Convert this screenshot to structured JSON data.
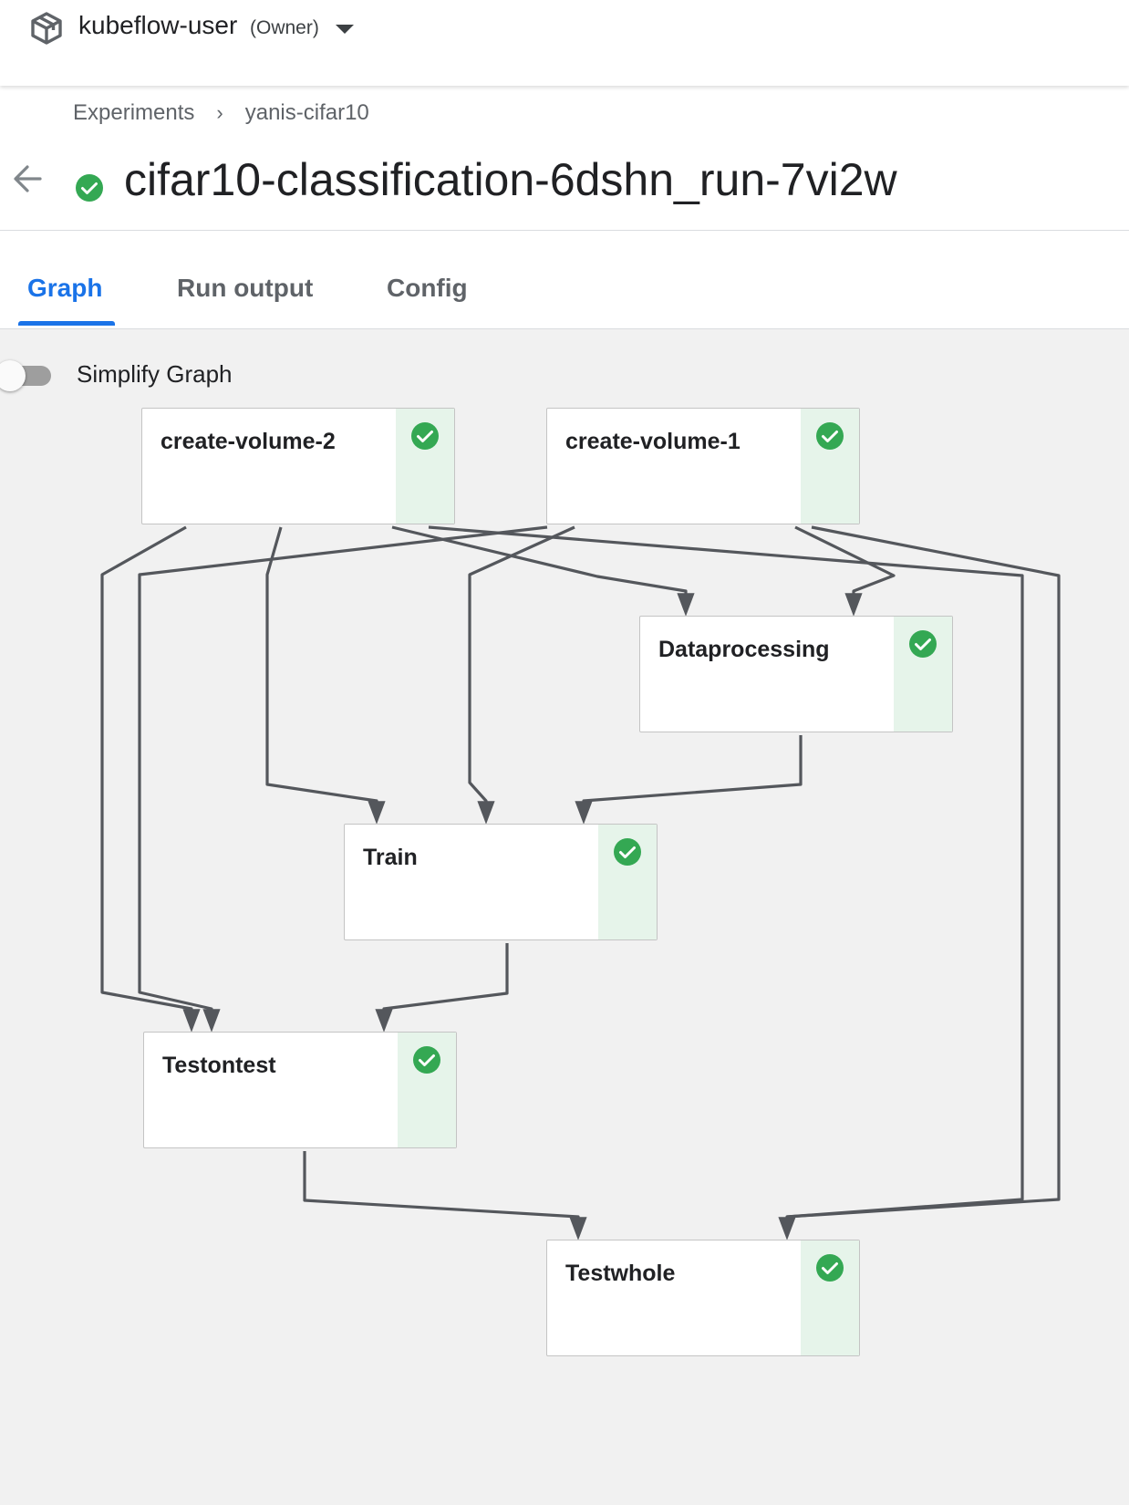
{
  "header": {
    "namespace": "kubeflow-user",
    "role": "(Owner)",
    "namespace_icon": "package-icon",
    "dropdown_icon": "caret-down-icon"
  },
  "breadcrumb": {
    "parent": "Experiments",
    "separator": "›",
    "current": "yanis-cifar10"
  },
  "run": {
    "title": "cifar10-classification-6dshn_run-7vi2w",
    "status": "succeeded",
    "status_icon": "check-circle-icon",
    "back_icon": "arrow-back-icon"
  },
  "tabs": [
    {
      "label": "Graph",
      "active": true
    },
    {
      "label": "Run output",
      "active": false
    },
    {
      "label": "Config",
      "active": false
    }
  ],
  "graph": {
    "simplify_label": "Simplify Graph",
    "simplify_enabled": false,
    "nodes": [
      {
        "label": "create-volume-2",
        "status": "succeeded"
      },
      {
        "label": "create-volume-1",
        "status": "succeeded"
      },
      {
        "label": "Dataprocessing",
        "status": "succeeded"
      },
      {
        "label": "Train",
        "status": "succeeded"
      },
      {
        "label": "Testontest",
        "status": "succeeded"
      },
      {
        "label": "Testwhole",
        "status": "succeeded"
      }
    ],
    "edges": [
      {
        "from": "create-volume-2",
        "to": "Dataprocessing"
      },
      {
        "from": "create-volume-1",
        "to": "Dataprocessing"
      },
      {
        "from": "create-volume-2",
        "to": "Train"
      },
      {
        "from": "create-volume-1",
        "to": "Train"
      },
      {
        "from": "Dataprocessing",
        "to": "Train"
      },
      {
        "from": "create-volume-2",
        "to": "Testontest"
      },
      {
        "from": "create-volume-1",
        "to": "Testontest"
      },
      {
        "from": "Train",
        "to": "Testontest"
      },
      {
        "from": "create-volume-2",
        "to": "Testwhole"
      },
      {
        "from": "create-volume-1",
        "to": "Testwhole"
      },
      {
        "from": "Testontest",
        "to": "Testwhole"
      }
    ]
  },
  "colors": {
    "accent": "#1a73e8",
    "success": "#34a853",
    "status_strip": "#e6f4ea",
    "edge": "#54575c",
    "canvas": "#f1f1f1"
  }
}
